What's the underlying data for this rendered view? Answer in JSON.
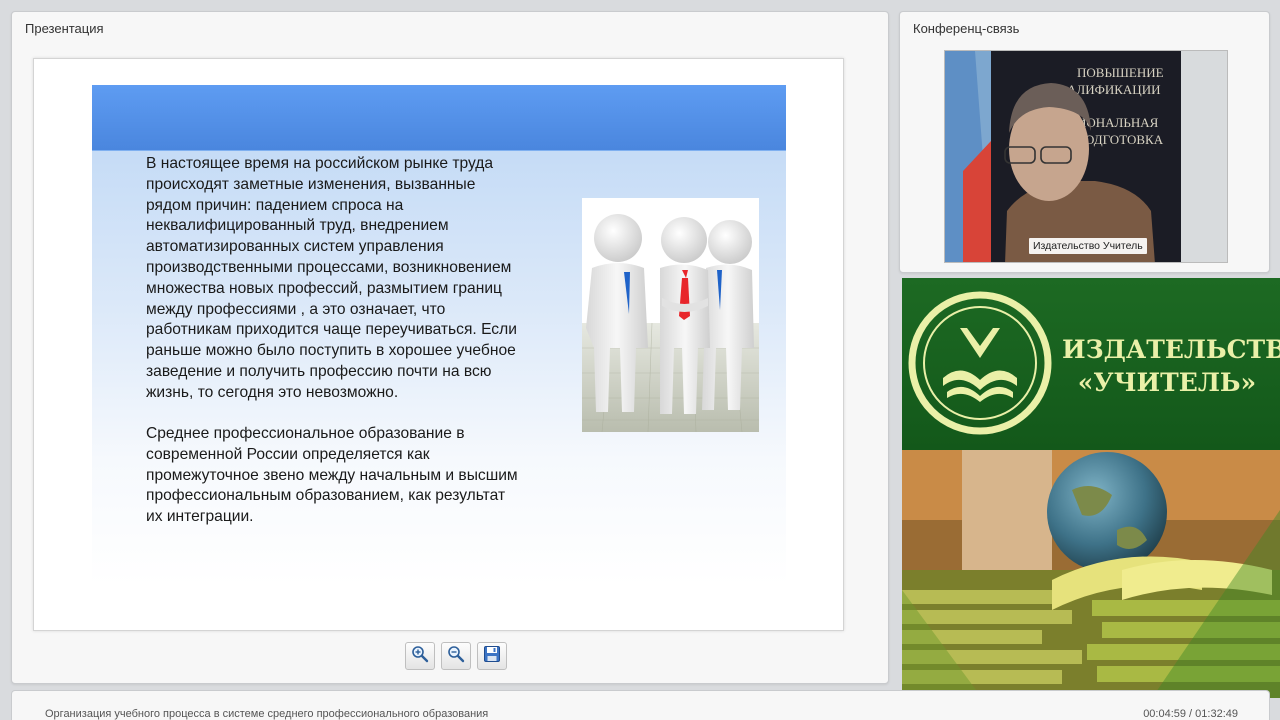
{
  "presentation_panel": {
    "title": "Презентация",
    "slide": {
      "paragraph1": "В настоящее время на российском рынке труда\nпроисходят заметные изменения, вызванные\nрядом причин: падением спроса на\nнеквалифицированный труд, внедрением\nавтоматизированных систем управления\nпроизводственными процессами, возникновением\nмножества новых профессий, размытием границ\nмежду профессиями , а это означает, что\nработникам приходится чаще переучиваться. Если\nраньше можно было поступить в хорошее учебное\nзаведение и получить профессию почти на всю\nжизнь, то сегодня это невозможно.",
      "paragraph2": "Среднее профессиональное образование в\nсовременной России определяется как\nпромежуточное звено между начальным и высшим\nпрофессиональным образованием, как результат\nих интеграции."
    },
    "toolbar": {
      "zoom_in_icon": "zoom-in-icon",
      "zoom_out_icon": "zoom-out-icon",
      "save_icon": "floppy-disk-icon"
    }
  },
  "conference_panel": {
    "title": "Конференц-связь",
    "video_label": "Издательство Учитель",
    "poster_text": [
      "ПОВЫШЕНИЕ",
      "АЛИФИКАЦИИ",
      "ИОНАЛЬНАЯ",
      "ОДГОТОВКА"
    ]
  },
  "banner": {
    "title": "ИЗДАТЕЛЬСТВО\n«УЧИТЕЛЬ»"
  },
  "footer": {
    "course_title": "Организация учебного процесса в системе среднего профессионального образования",
    "time": "00:04:59 / 01:32:49"
  },
  "colors": {
    "slide_band": "#4f8ce5",
    "banner_green": "#13581a",
    "banner_text": "#eaf0a8",
    "tie_red": "#e8262b",
    "tie_blue": "#1f63c9"
  }
}
